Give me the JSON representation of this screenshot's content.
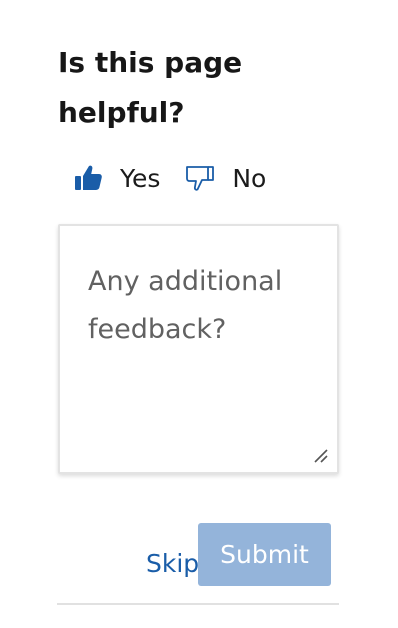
{
  "feedback_widget": {
    "question": "Is this page helpful?",
    "yes": {
      "label": "Yes",
      "icon": "thumbs-up-filled",
      "selected": true,
      "color": "#1a5da8"
    },
    "no": {
      "label": "No",
      "icon": "thumbs-down-outline",
      "selected": false,
      "color": "#1a5da8"
    },
    "comment": {
      "value": "",
      "placeholder": "Any additional feedback?"
    },
    "skip_label": "Skip",
    "submit_label": "Submit",
    "submit_color": "#94b4da",
    "link_color": "#1a5da8"
  }
}
